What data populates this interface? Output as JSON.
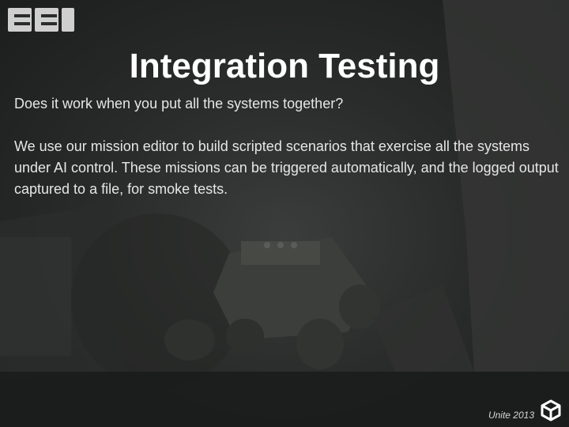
{
  "slide": {
    "logo_text": "BBI",
    "title": "Integration Testing",
    "paragraphs": [
      "Does it work when you put all the systems together?",
      "We use our mission editor to build scripted scenarios that exercise all the systems under AI control. These missions can be triggered automatically, and the logged output captured to a file, for smoke tests."
    ],
    "footer": "Unite 2013",
    "footer_icon": "unity-logo-icon"
  },
  "colors": {
    "background": "#2a2c2b",
    "title": "#ffffff",
    "body_text": "#e6e6e6",
    "logo": "#cfcfcf"
  }
}
